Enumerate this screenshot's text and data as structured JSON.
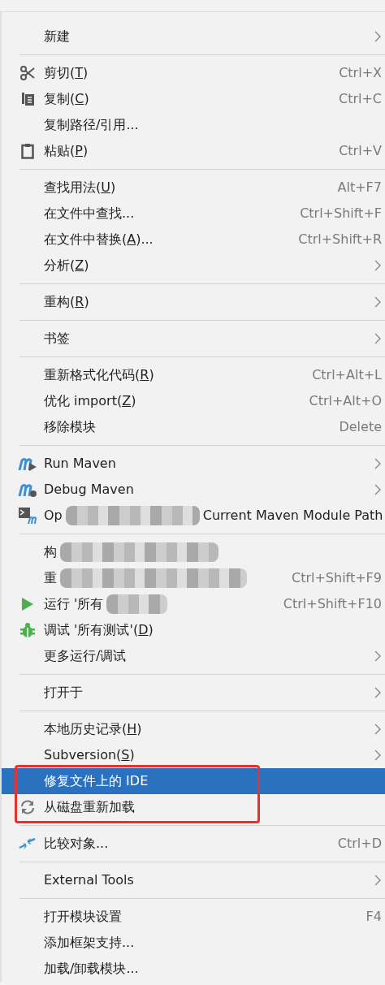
{
  "menu_groups": [
    [
      {
        "label": "新建",
        "submenu": true,
        "selected": false
      }
    ],
    [
      {
        "label": "剪切(",
        "mnemonic": "T",
        "label_end": ")",
        "kind": "scissors",
        "shortcut": "Ctrl+X",
        "selected": false
      },
      {
        "label": "复制(",
        "mnemonic": "C",
        "label_end": ")",
        "kind": "copy",
        "shortcut": "Ctrl+C",
        "selected": false
      },
      {
        "label": "复制路径/引用...",
        "selected": false
      },
      {
        "label": "粘贴(",
        "mnemonic": "P",
        "label_end": ")",
        "kind": "clipboard",
        "shortcut": "Ctrl+V",
        "selected": false
      }
    ],
    [
      {
        "label": "查找用法(",
        "mnemonic": "U",
        "label_end": ")",
        "shortcut": "Alt+F7",
        "selected": false
      },
      {
        "label": "在文件中查找...",
        "shortcut": "Ctrl+Shift+F",
        "selected": false
      },
      {
        "label": "在文件中替换(",
        "mnemonic": "A",
        "label_end": ")...",
        "shortcut": "Ctrl+Shift+R",
        "selected": false
      },
      {
        "label": "分析(",
        "mnemonic": "Z",
        "label_end": ")",
        "submenu": true,
        "selected": false
      }
    ],
    [
      {
        "label": "重构(",
        "mnemonic": "R",
        "label_end": ")",
        "submenu": true,
        "selected": false
      }
    ],
    [
      {
        "label": "书签",
        "submenu": true,
        "selected": false
      }
    ],
    [
      {
        "label": "重新格式化代码(",
        "mnemonic": "R",
        "label_end": ")",
        "shortcut": "Ctrl+Alt+L",
        "selected": false
      },
      {
        "label": "优化 import(",
        "mnemonic": "Z",
        "label_end": ")",
        "shortcut": "Ctrl+Alt+O",
        "selected": false
      },
      {
        "label": "移除模块",
        "shortcut": "Delete",
        "selected": false
      }
    ],
    [
      {
        "label": "Run Maven",
        "kind": "maven-run",
        "submenu": true,
        "selected": false
      },
      {
        "label": "Debug Maven",
        "kind": "maven-debug",
        "submenu": true,
        "selected": false
      },
      {
        "label": "Op",
        "redacted": true,
        "tail": "Current Maven Module Path",
        "kind": "terminal",
        "selected": false
      }
    ],
    [
      {
        "label": "构",
        "redacted": true,
        "selected": false
      },
      {
        "label": "重",
        "redacted": true,
        "shortcut": "Ctrl+Shift+F9",
        "selected": false
      },
      {
        "label": "运行 '所有",
        "redacted": true,
        "kind": "run",
        "shortcut": "Ctrl+Shift+F10",
        "selected": false
      },
      {
        "label": "调试 '所有测试'(",
        "mnemonic": "D",
        "label_end": ")",
        "kind": "bug",
        "selected": false
      },
      {
        "label": "更多运行/调试",
        "submenu": true,
        "selected": false
      }
    ],
    [
      {
        "label": "打开于",
        "submenu": true,
        "selected": false
      }
    ],
    [
      {
        "label": "本地历史记录(",
        "mnemonic": "H",
        "label_end": ")",
        "submenu": true,
        "selected": false
      },
      {
        "label": "Subversion(",
        "mnemonic": "S",
        "label_end": ")",
        "submenu": true,
        "selected": false
      },
      {
        "label": "修复文件上的 IDE",
        "selected": true,
        "framed": true
      },
      {
        "label": "从磁盘重新加载",
        "kind": "reload",
        "selected": false,
        "framed": true
      }
    ],
    [
      {
        "label": "比较对象...",
        "kind": "compare",
        "shortcut": "Ctrl+D",
        "selected": false
      }
    ],
    [
      {
        "label": "External Tools",
        "submenu": true,
        "selected": false
      }
    ],
    [
      {
        "label": "打开模块设置",
        "shortcut": "F4",
        "selected": false
      },
      {
        "label": "添加框架支持...",
        "selected": false
      },
      {
        "label": "加载/卸载模块...",
        "selected": false
      }
    ]
  ],
  "annotation_frame": {
    "color": "#e8312a"
  }
}
